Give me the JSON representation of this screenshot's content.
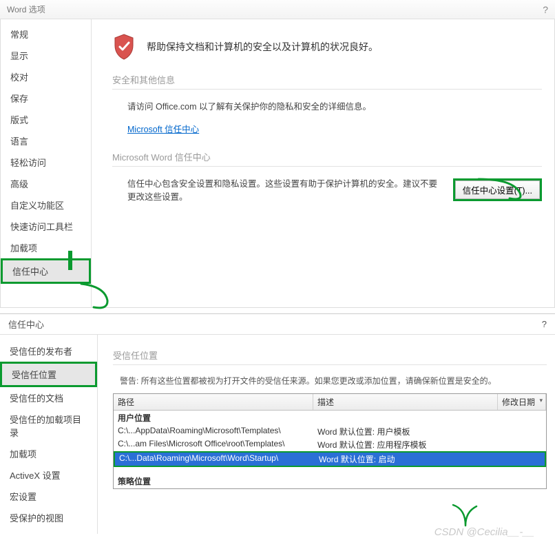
{
  "dialog1": {
    "title": "Word 选项",
    "help": "?",
    "sidebar": [
      "常规",
      "显示",
      "校对",
      "保存",
      "版式",
      "语言",
      "轻松访问",
      "高级",
      "自定义功能区",
      "快速访问工具栏",
      "加载项",
      "信任中心"
    ],
    "selected_index": 11,
    "hero": "帮助保持文档和计算机的安全以及计算机的状况良好。",
    "sec1_title": "安全和其他信息",
    "sec1_body": "请访问 Office.com  以了解有关保护你的隐私和安全的详细信息。",
    "link_text": "Microsoft 信任中心",
    "sec2_title": "Microsoft Word 信任中心",
    "sec2_body": "信任中心包含安全设置和隐私设置。这些设置有助于保护计算机的安全。建议不要更改这些设置。",
    "btn_label": "信任中心设置(T)..."
  },
  "dialog2": {
    "title": "信任中心",
    "help": "?",
    "sidebar": [
      "受信任的发布者",
      "受信任位置",
      "受信任的文档",
      "受信任的加载项目录",
      "加载项",
      "ActiveX 设置",
      "宏设置",
      "受保护的视图"
    ],
    "selected_index": 1,
    "heading": "受信任位置",
    "warning": "警告: 所有这些位置都被视为打开文件的受信任来源。如果您更改或添加位置，请确保新位置是安全的。",
    "columns": {
      "path": "路径",
      "desc": "描述",
      "date": "修改日期"
    },
    "group1": "用户位置",
    "rows": [
      {
        "path": "C:\\...AppData\\Roaming\\Microsoft\\Templates\\",
        "desc": "Word 默认位置: 用户模板"
      },
      {
        "path": "C:\\...am Files\\Microsoft Office\\root\\Templates\\",
        "desc": "Word 默认位置: 应用程序模板"
      },
      {
        "path": "C:\\...Data\\Roaming\\Microsoft\\Word\\Startup\\",
        "desc": "Word 默认位置: 启动"
      }
    ],
    "selected_row": 2,
    "group2": "策略位置"
  },
  "watermark": "CSDN @Cecilia__-__"
}
